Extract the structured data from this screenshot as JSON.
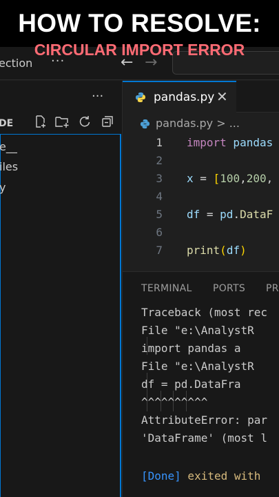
{
  "overlay": {
    "title": "HOW TO RESOLVE:",
    "subtitle": "CIRCULAR IMPORT ERROR"
  },
  "titlebar": {
    "left_text": "ection",
    "more_label": "···",
    "back_icon": "arrow-left-icon",
    "forward_icon": "arrow-right-icon"
  },
  "explorer": {
    "more_label": "···",
    "section_label": "DE",
    "icons": [
      "new-file-icon",
      "new-folder-icon",
      "refresh-icon",
      "collapse-all-icon"
    ],
    "items": [
      {
        "label": "e__"
      },
      {
        "label": "iles"
      },
      {
        "label": "y"
      }
    ]
  },
  "editor": {
    "tab": {
      "label": "pandas.py",
      "icon": "python-icon",
      "close": "✕"
    },
    "breadcrumb": {
      "file": "pandas.py",
      "separator": ">",
      "rest": "..."
    },
    "lines": [
      {
        "n": "1",
        "parts": [
          {
            "t": "import",
            "c": "kw"
          },
          {
            "t": " pandas",
            "c": "id"
          }
        ]
      },
      {
        "n": "2",
        "parts": []
      },
      {
        "n": "3",
        "parts": [
          {
            "t": "x",
            "c": "id"
          },
          {
            "t": " = ",
            "c": "op"
          },
          {
            "t": "[",
            "c": "br"
          },
          {
            "t": "100",
            "c": "num"
          },
          {
            "t": ",",
            "c": "op"
          },
          {
            "t": "200",
            "c": "num"
          },
          {
            "t": ",",
            "c": "op"
          }
        ]
      },
      {
        "n": "4",
        "parts": []
      },
      {
        "n": "5",
        "parts": [
          {
            "t": "df",
            "c": "id"
          },
          {
            "t": " = ",
            "c": "op"
          },
          {
            "t": "pd",
            "c": "id"
          },
          {
            "t": ".",
            "c": "op"
          },
          {
            "t": "DataF",
            "c": "fn"
          }
        ]
      },
      {
        "n": "6",
        "parts": []
      },
      {
        "n": "7",
        "parts": [
          {
            "t": "print",
            "c": "fn"
          },
          {
            "t": "(",
            "c": "br"
          },
          {
            "t": "df",
            "c": "id"
          },
          {
            "t": ")",
            "c": "br"
          }
        ]
      }
    ]
  },
  "panel": {
    "tabs": [
      "TERMINAL",
      "PORTS",
      "PRO"
    ],
    "terminal": [
      "Traceback (most rec",
      "  File \"e:\\AnalystR",
      "    import pandas a",
      "  File \"e:\\AnalystR",
      "    df = pd.DataFra",
      "         ^^^^^^^^^^",
      "AttributeError: par",
      "'DataFrame' (most l"
    ],
    "done_label": "[Done]",
    "exited_label": " exited with"
  }
}
